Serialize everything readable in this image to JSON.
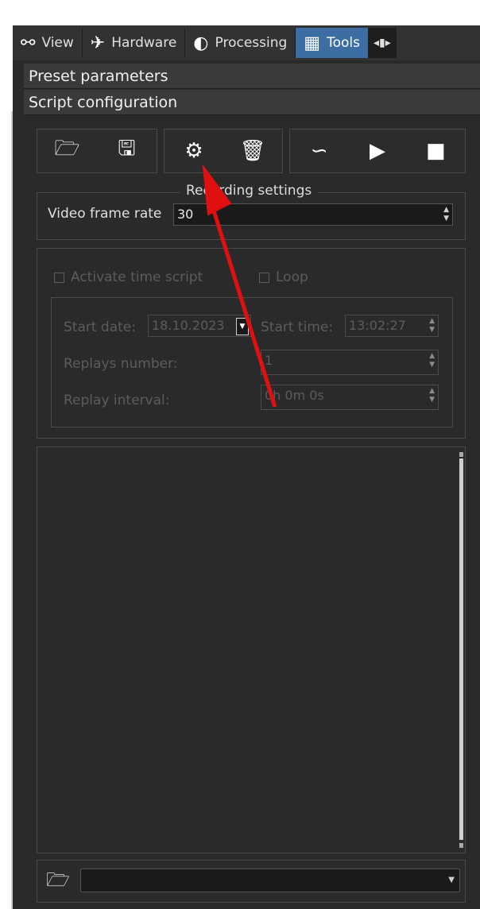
{
  "tabs": [
    {
      "label": "View",
      "icon": "glasses-icon",
      "glyph": "⚯"
    },
    {
      "label": "Hardware",
      "icon": "airplane-icon",
      "glyph": "✈"
    },
    {
      "label": "Processing",
      "icon": "contrast-icon",
      "glyph": "◐"
    },
    {
      "label": "Tools",
      "icon": "grid-icon",
      "glyph": "▦"
    }
  ],
  "sections": {
    "preset": "Preset parameters",
    "script": "Script configuration"
  },
  "toolbar": {
    "open_glyph": "🗁",
    "save_glyph": "🖫",
    "add_glyph": "⚙",
    "delete_glyph": "🗑",
    "curve_glyph": "∽",
    "play_glyph": "▶",
    "record_glyph": "■"
  },
  "recording": {
    "title": "Recording settings",
    "frame_rate_label": "Video frame rate",
    "frame_rate_value": "30"
  },
  "time_script": {
    "activate_label": "Activate time script",
    "loop_label": "Loop",
    "start_date_label": "Start date:",
    "start_date_value": "18.10.2023",
    "start_time_label": "Start time:",
    "start_time_value": "13:02:27",
    "replays_label": "Replays number:",
    "replays_value": "1",
    "interval_label": "Replay interval:",
    "interval_value": "0h 0m 0s"
  },
  "colors": {
    "accent": "#3c6ea3",
    "annotation_arrow": "#e01010"
  }
}
